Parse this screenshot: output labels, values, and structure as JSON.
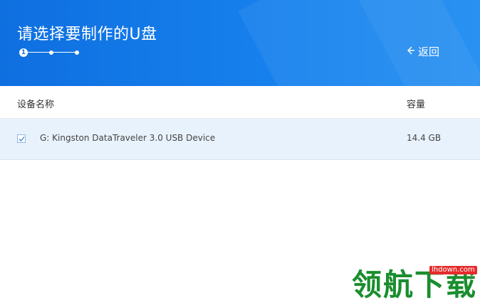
{
  "header": {
    "title": "请选择要制作的U盘",
    "back_label": "返回",
    "back_icon": "arrow-left-icon",
    "steps": {
      "current_label": "1",
      "total": 3,
      "current": 1
    }
  },
  "table": {
    "columns": [
      "设备名称",
      "容量"
    ],
    "rows": [
      {
        "checked": true,
        "device": "G: Kingston DataTraveler 3.0 USB Device",
        "capacity": "14.4 GB"
      }
    ]
  },
  "watermark": {
    "text": "领航下载",
    "url": "lhdown.com"
  },
  "colors": {
    "header_blue": "#1479e6",
    "row_selected": "#e8f2fc",
    "watermark_green": "#1a8e2e",
    "watermark_red": "#e52b2b"
  }
}
